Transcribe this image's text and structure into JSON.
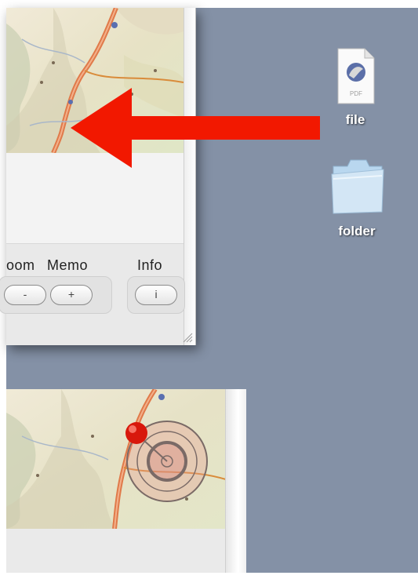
{
  "desktop": {
    "icons": [
      {
        "name": "file",
        "label": "file",
        "badge": "PDF"
      },
      {
        "name": "folder",
        "label": "folder"
      }
    ]
  },
  "window_top": {
    "controls": {
      "zoom": {
        "label": "oom",
        "minus": "-",
        "plus": "+"
      },
      "memo": {
        "label": "Memo"
      },
      "info": {
        "label": "Info",
        "button": "i"
      }
    }
  },
  "annotation": {
    "arrow_color": "#f21800"
  }
}
